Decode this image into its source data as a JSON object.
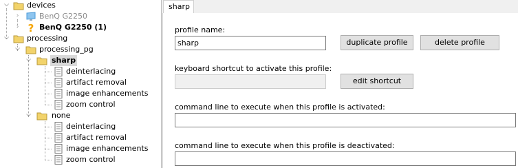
{
  "tree": {
    "devices": {
      "label": "devices"
    },
    "device_gray": {
      "label": "BenQ G2250"
    },
    "device_unknown": {
      "label": "BenQ G2250 (1)"
    },
    "processing": {
      "label": "processing"
    },
    "processing_pg": {
      "label": "processing_pg"
    },
    "sharp": {
      "label": "sharp",
      "children": [
        "deinterlacing",
        "artifact removal",
        "image enhancements",
        "zoom control"
      ]
    },
    "none": {
      "label": "none",
      "children": [
        "deinterlacing",
        "artifact removal",
        "image enhancements",
        "zoom control"
      ]
    }
  },
  "tab": {
    "label": "sharp"
  },
  "form": {
    "profile_name_label": "profile name:",
    "profile_name_value": "sharp",
    "duplicate_label": "duplicate profile",
    "delete_label": "delete profile",
    "shortcut_label": "keyboard shortcut to activate this profile:",
    "shortcut_value": "",
    "edit_shortcut_label": "edit shortcut",
    "cmd_activate_label": "command line to execute when this profile is activated:",
    "cmd_activate_value": "",
    "cmd_deactivate_label": "command line to execute when this profile is deactivated:",
    "cmd_deactivate_value": ""
  },
  "icons": {
    "folder": "folder-icon",
    "folder_open": "folder-open-icon",
    "monitor": "monitor-icon",
    "unknown": "question-icon",
    "page": "page-icon"
  },
  "colors": {
    "folder": "#f2d36b",
    "selection": "#d9d9d9",
    "question": "#f5a400",
    "monitor": "#4a9ad8"
  }
}
